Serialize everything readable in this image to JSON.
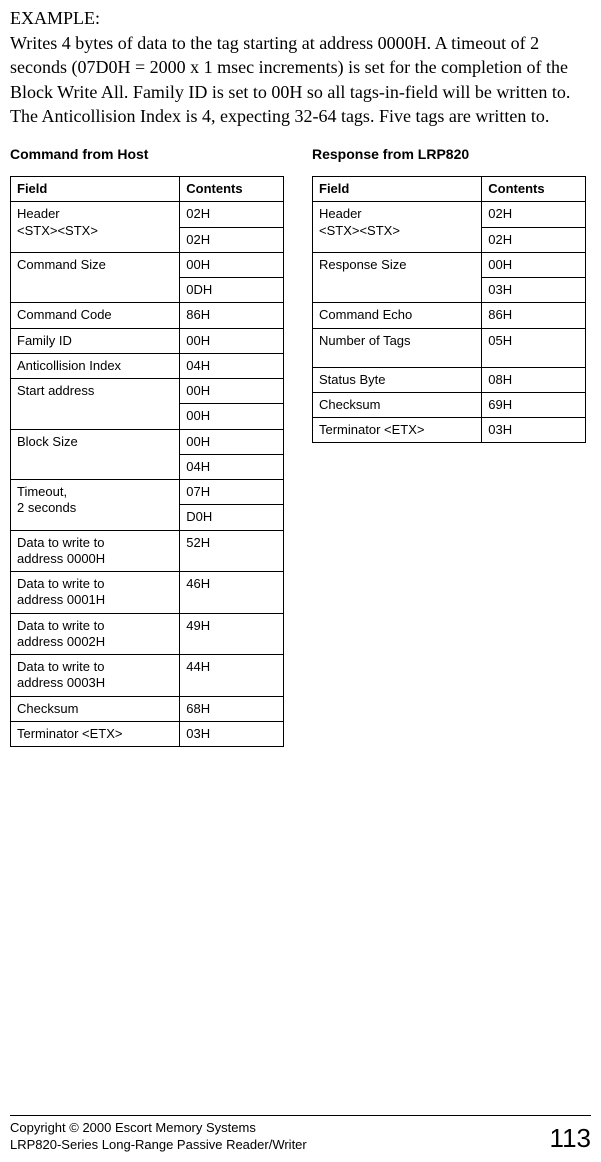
{
  "header": {
    "example_label": "EXAMPLE:",
    "intro": "Writes 4 bytes of data to the tag starting at address 0000H. A timeout of 2 seconds (07D0H = 2000 x 1 msec increments) is set for the completion of the Block Write All. Family ID is set to 00H so all tags-in-field will be written to.  The Anticollision Index is 4, expecting 32-64 tags.  Five tags are written to."
  },
  "command": {
    "title": "Command from Host",
    "headers": {
      "field": "Field",
      "contents": "Contents"
    },
    "rows": [
      {
        "field": "Header\n<STX><STX>",
        "values": [
          "02H",
          "02H"
        ]
      },
      {
        "field": "Command Size",
        "values": [
          "00H",
          "0DH"
        ]
      },
      {
        "field": "Command Code",
        "values": [
          "86H"
        ]
      },
      {
        "field": "Family ID",
        "values": [
          "00H"
        ]
      },
      {
        "field": "Anticollision Index",
        "values": [
          "04H"
        ]
      },
      {
        "field": "Start address",
        "values": [
          "00H",
          "00H"
        ]
      },
      {
        "field": "Block Size",
        "values": [
          "00H",
          "04H"
        ]
      },
      {
        "field": "Timeout,\n2 seconds",
        "values": [
          "07H",
          "D0H"
        ]
      },
      {
        "field": "Data to write to\naddress 0000H",
        "values": [
          "52H"
        ],
        "tall": true
      },
      {
        "field": "Data to write to\naddress 0001H",
        "values": [
          "46H"
        ],
        "tall": true
      },
      {
        "field": "Data to write to\naddress 0002H",
        "values": [
          "49H"
        ],
        "tall": true
      },
      {
        "field": "Data to write to\naddress 0003H",
        "values": [
          "44H"
        ],
        "tall": true
      },
      {
        "field": "Checksum",
        "values": [
          "68H"
        ]
      },
      {
        "field": "Terminator <ETX>",
        "values": [
          "03H"
        ]
      }
    ]
  },
  "response": {
    "title": "Response from LRP820",
    "headers": {
      "field": "Field",
      "contents": "Contents"
    },
    "rows": [
      {
        "field": "Header\n<STX><STX>",
        "values": [
          "02H",
          "02H"
        ]
      },
      {
        "field": "Response Size",
        "values": [
          "00H",
          "03H"
        ]
      },
      {
        "field": "Command Echo",
        "values": [
          "86H"
        ]
      },
      {
        "field": "Number of Tags",
        "values": [
          "05H"
        ],
        "tall": true
      },
      {
        "field": "Status Byte",
        "values": [
          "08H"
        ]
      },
      {
        "field": "Checksum",
        "values": [
          "69H"
        ]
      },
      {
        "field": "Terminator <ETX>",
        "values": [
          "03H"
        ]
      }
    ]
  },
  "footer": {
    "line1": "Copyright © 2000 Escort Memory Systems",
    "line2": "LRP820-Series Long-Range Passive Reader/Writer",
    "page": "113"
  }
}
